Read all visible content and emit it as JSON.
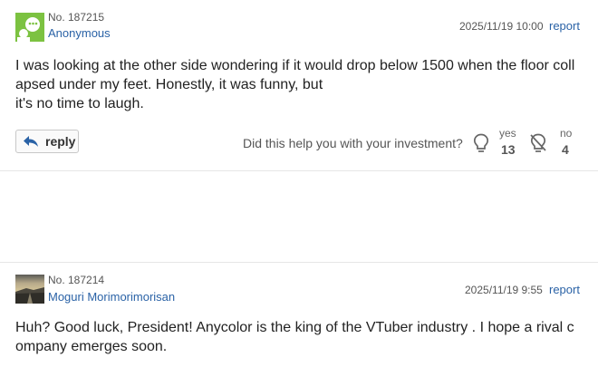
{
  "posts": [
    {
      "number": "No. 187215",
      "author": "Anonymous",
      "date": "2025/11/19 10:00",
      "report": "report",
      "lines": [
        "I was looking at the other side wondering if it would drop below 1500 when the floor coll",
        "apsed under my feet. Honestly, it was funny, but",
        "it's no time to laugh."
      ],
      "reply": "reply",
      "question": "Did this help you with your investment?",
      "yes_label": "yes",
      "yes_count": "13",
      "no_label": "no",
      "no_count": "4"
    },
    {
      "number": "No. 187214",
      "author": "Moguri Morimorimorisan",
      "date": "2025/11/19 9:55",
      "report": "report",
      "lines": [
        "Huh? Good luck, President! Anycolor is the king of the VTuber industry . I hope a rival c",
        "ompany emerges soon."
      ]
    }
  ],
  "colors": {
    "link": "#2a62a6",
    "avatar_green": "#7cc241"
  }
}
